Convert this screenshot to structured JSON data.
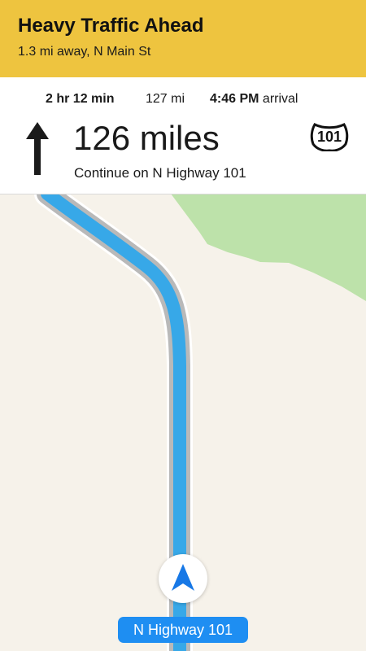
{
  "banner": {
    "title": "Heavy Traffic Ahead",
    "subtitle": "1.3 mi away, N Main St",
    "color": "#EEC43F"
  },
  "navigation": {
    "trip_duration": "2 hr 12 min",
    "trip_distance": "127 mi",
    "arrival_time": "4:46 PM",
    "arrival_label": "arrival",
    "maneuver_icon": "straight-arrow-icon",
    "main_distance": "126 miles",
    "instruction": "Continue on N Highway 101",
    "route_shield": "101"
  },
  "map": {
    "current_road": "N Highway 101",
    "location_icon": "navigation-arrow-icon",
    "route_color": "#37A8E8",
    "land_color": "#F6F2EA",
    "park_color": "#BDE2AA"
  }
}
